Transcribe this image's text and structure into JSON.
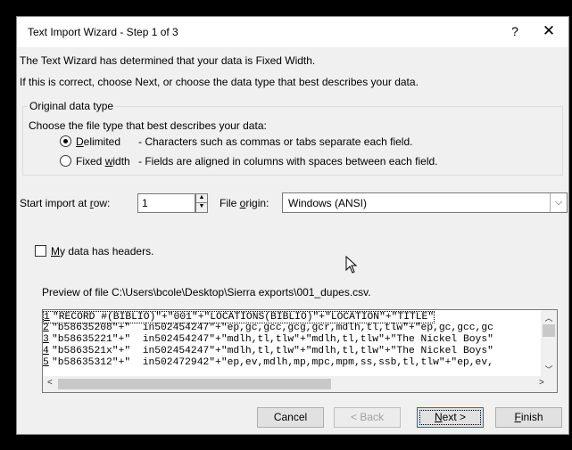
{
  "window": {
    "title": "Text Import Wizard - Step 1 of 3",
    "help_glyph": "?",
    "close_glyph": "✕"
  },
  "intro": {
    "line1": "The Text Wizard has determined that your data is Fixed Width.",
    "line2": "If this is correct, choose Next, or choose the data type that best describes your data."
  },
  "original_data_type": {
    "legend": "Original data type",
    "prompt": "Choose the file type that best describes your data:",
    "options": [
      {
        "label_u": "D",
        "label_rest": "elimited",
        "desc": "- Characters such as commas or tabs separate each field.",
        "selected": true
      },
      {
        "label_pre": "Fixed ",
        "label_u": "w",
        "label_rest": "idth",
        "desc": "- Fields are aligned in columns with spaces between each field.",
        "selected": false
      }
    ]
  },
  "start_row": {
    "label_pre": "Start import at ",
    "label_u": "r",
    "label_rest": "ow:",
    "value": "1"
  },
  "file_origin": {
    "label_pre": "File ",
    "label_u": "o",
    "label_rest": "rigin:",
    "value": "Windows (ANSI)"
  },
  "headers_checkbox": {
    "label_u": "M",
    "label_rest": "y data has headers.",
    "checked": false
  },
  "preview": {
    "caption": "Preview of file C:\\Users\\bcole\\Desktop\\Sierra exports\\001_dupes.csv.",
    "rows": [
      {
        "num": "1",
        "text": "\"RECORD #(BIBLIO)\"+\"001\"+\"LOCATIONS(BIBLIO)\"+\"LOCATION\"+\"TITLE\""
      },
      {
        "num": "2",
        "text": "\"b58635208\"+\"  in502454247\"+\"ep,gc,gcc,gcg,gcr,mdlh,tl,tlw\"+\"ep,gc,gcc,gc"
      },
      {
        "num": "3",
        "text": "\"b58635221\"+\"  in502454247\"+\"mdlh,tl,tlw\"+\"mdlh,tl,tlw\"+\"The Nickel Boys\""
      },
      {
        "num": "4",
        "text": "\"b5863521x\"+\"  in502454247\"+\"mdlh,tl,tlw\"+\"mdlh,tl,tlw\"+\"The Nickel Boys\""
      },
      {
        "num": "5",
        "text": "\"b58635312\"+\"  in502472942\"+\"ep,ev,mdlh,mp,mpc,mpm,ss,ssb,tl,tlw\"+\"ep,ev,"
      }
    ]
  },
  "buttons": {
    "cancel": "Cancel",
    "back": "< Back",
    "next_u": "N",
    "next_rest": "ext >",
    "finish_u": "F",
    "finish_rest": "inish"
  }
}
